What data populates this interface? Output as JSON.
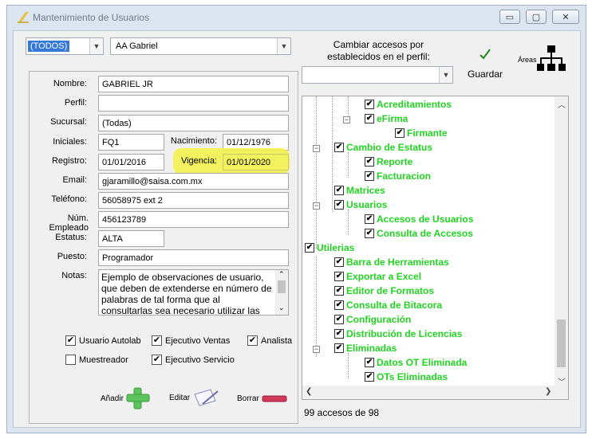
{
  "window": {
    "title": "Mantenimiento de Usuarios"
  },
  "top": {
    "filter_value": "(TODOS)",
    "user_value": "AA Gabriel"
  },
  "perfil": {
    "label": "Cambiar accesos por establecidos en el perfil:",
    "value": "",
    "save_label": "Guardar",
    "areas_label": "Áreas"
  },
  "form": {
    "nombre": {
      "label": "Nombre:",
      "value": "GABRIEL JR"
    },
    "perfil": {
      "label": "Perfil:",
      "value": ""
    },
    "sucursal": {
      "label": "Sucursal:",
      "value": "(Todas)"
    },
    "iniciales": {
      "label": "Iniciales:",
      "value": "FQ1"
    },
    "nacimiento": {
      "label": "Nacimiento:",
      "value": "01/12/1976"
    },
    "registro": {
      "label": "Registro:",
      "value": "01/01/2016"
    },
    "vigencia": {
      "label": "Vigencia:",
      "value": "01/01/2020"
    },
    "email": {
      "label": "Email:",
      "value": "gjaramillo@saisa.com.mx"
    },
    "telefono": {
      "label": "Teléfono:",
      "value": "56058975 ext 2"
    },
    "num_empleado": {
      "label": "Núm. Empleado",
      "value": "456123789"
    },
    "estatus": {
      "label": "Estatus:",
      "value": "ALTA"
    },
    "puesto": {
      "label": "Puesto:",
      "value": "Programador"
    },
    "notas": {
      "label": "Notas:",
      "value": "Ejemplo de observaciones de usuario, que deben de extenderse en número de palabras de tal forma que al consultarlas sea necesario utilizar las"
    }
  },
  "checks": [
    {
      "label": "Usuario Autolab",
      "checked": true
    },
    {
      "label": "Ejecutivo Ventas",
      "checked": true
    },
    {
      "label": "Analista",
      "checked": true
    },
    {
      "label": "Muestreador",
      "checked": false
    },
    {
      "label": "Ejecutivo Servicio",
      "checked": true
    }
  ],
  "actions": {
    "add": "Añadir",
    "edit": "Editar",
    "delete": "Borrar"
  },
  "tree": [
    {
      "label": "Acreditamientos",
      "level": 2
    },
    {
      "label": "eFirma",
      "level": 2
    },
    {
      "label": "Firmante",
      "level": 3
    },
    {
      "label": "Cambio de Estatus",
      "level": 1
    },
    {
      "label": "Reporte",
      "level": 2
    },
    {
      "label": "Facturacion",
      "level": 2
    },
    {
      "label": "Matrices",
      "level": 1
    },
    {
      "label": "Usuarios",
      "level": 1
    },
    {
      "label": "Accesos de Usuarios",
      "level": 2
    },
    {
      "label": "Consulta de Accesos",
      "level": 2
    },
    {
      "label": "Utilerias",
      "level": 0
    },
    {
      "label": "Barra de Herramientas",
      "level": 1
    },
    {
      "label": "Exportar a Excel",
      "level": 1
    },
    {
      "label": "Editor de Formatos",
      "level": 1
    },
    {
      "label": "Consulta de Bitacora",
      "level": 1
    },
    {
      "label": "Configuración",
      "level": 1
    },
    {
      "label": "Distribución de Licencias",
      "level": 1
    },
    {
      "label": "Eliminadas",
      "level": 1
    },
    {
      "label": "Datos OT Eliminada",
      "level": 2
    },
    {
      "label": "OTs Eliminadas",
      "level": 2
    }
  ],
  "status": {
    "count_text": "99 accesos de 98"
  },
  "colors": {
    "tree_text": "#22d422",
    "highlight": "#f3f14e",
    "add": "#5cc45c",
    "delete": "#d23a5a"
  }
}
